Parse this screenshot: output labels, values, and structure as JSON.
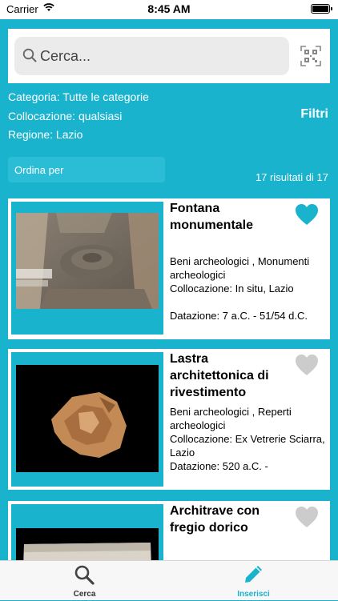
{
  "status_bar": {
    "carrier": "Carrier",
    "time": "8:45 AM"
  },
  "search": {
    "placeholder": "Cerca..."
  },
  "filters": {
    "categoria": "Categoria: Tutte le categorie",
    "collocazione": "Collocazione: qualsiasi",
    "regione": "Regione: Lazio",
    "button_label": "Filtri"
  },
  "sort": {
    "label": "Ordina per"
  },
  "results_count": "17 risultati di 17",
  "results": [
    {
      "title": "Fontana monumentale",
      "category": "Beni archeologici , Monumenti archeologici",
      "location": "Collocazione: In situ, Lazio",
      "date": "Datazione: 7 a.C. - 51/54 d.C.",
      "favorite": true
    },
    {
      "title": "Lastra architettonica di rivestimento",
      "category": "Beni archeologici , Reperti archeologici",
      "location": "Collocazione: Ex Vetrerie Sciarra, Lazio",
      "date": "Datazione: 520 a.C. -",
      "favorite": false
    },
    {
      "title": "Architrave con fregio dorico",
      "favorite": false
    }
  ],
  "tabbar": {
    "search_label": "Cerca",
    "insert_label": "Inserisci"
  },
  "colors": {
    "accent": "#19b3cd",
    "favorite_on": "#19b3cd",
    "favorite_off": "#cccccc"
  }
}
